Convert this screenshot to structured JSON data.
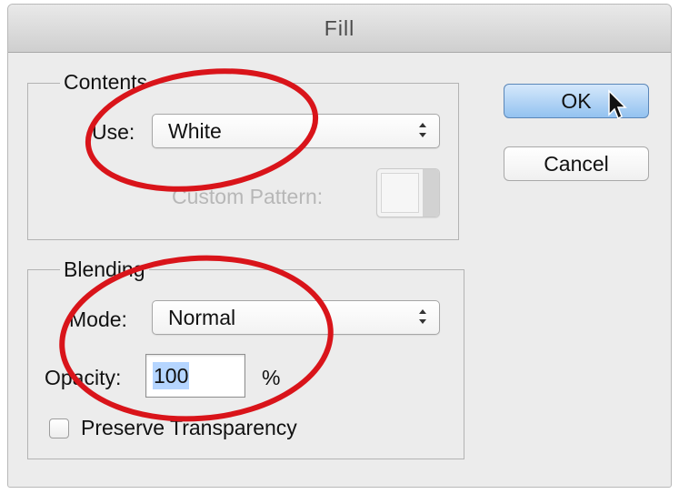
{
  "dialog": {
    "title": "Fill"
  },
  "contents": {
    "group_label": "Contents",
    "use_label": "Use:",
    "use_value": "White",
    "custom_pattern_label": "Custom Pattern:"
  },
  "blending": {
    "group_label": "Blending",
    "mode_label": "Mode:",
    "mode_value": "Normal",
    "opacity_label": "Opacity:",
    "opacity_value": "100",
    "opacity_unit": "%",
    "preserve_transparency_label": "Preserve Transparency",
    "preserve_transparency_checked": false
  },
  "buttons": {
    "ok_label": "OK",
    "cancel_label": "Cancel"
  },
  "annotations": {
    "highlight_color": "#d9141a"
  },
  "icons": [
    "select-arrows-icon",
    "mouse-pointer-icon"
  ]
}
